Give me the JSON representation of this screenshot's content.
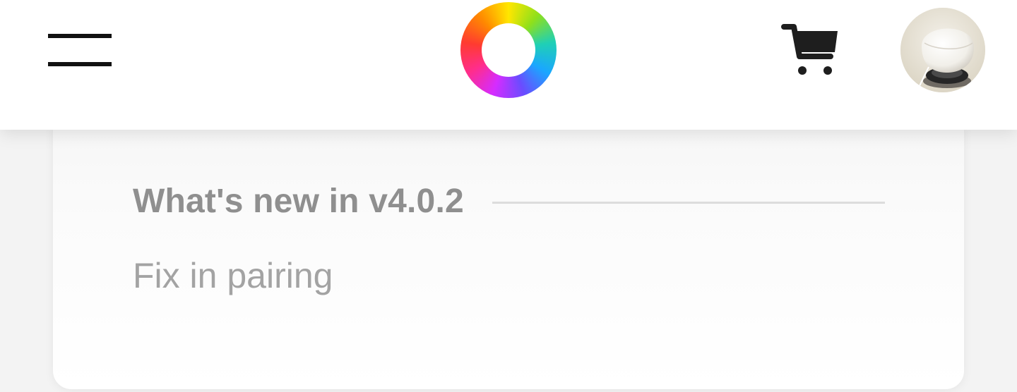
{
  "header": {
    "menu_icon": "hamburger-menu-icon",
    "logo_icon": "rainbow-ring-logo",
    "cart_icon": "shopping-cart-icon",
    "avatar_icon": "device-photo-avatar"
  },
  "release_notes": {
    "section_title": "What's new in v4.0.2",
    "items": [
      "Fix in pairing"
    ]
  },
  "colors": {
    "section_title": "#8f8f8f",
    "item_text": "#a3a3a3",
    "divider": "#dcdcdc",
    "header_bg": "#ffffff",
    "page_bg": "#f3f3f3"
  }
}
